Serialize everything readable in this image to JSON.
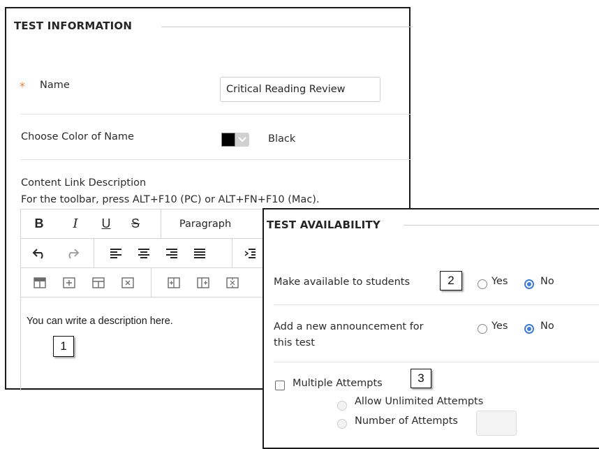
{
  "test_information": {
    "section_title": "TEST INFORMATION",
    "name_required_mark": "*",
    "name_label": "Name",
    "name_value": "Critical Reading Review",
    "color_label": "Choose Color of Name",
    "color_value": "Black",
    "color_swatch": "#000000",
    "content_label": "Content Link Description",
    "toolbar_hint": "For the toolbar, press ALT+F10 (PC) or ALT+FN+F10 (Mac).",
    "toolbar": {
      "bold": "B",
      "italic": "I",
      "underline": "U",
      "strikethrough": "S",
      "paragraph": "Paragraph"
    },
    "editor_text": "You can write a description here."
  },
  "test_availability": {
    "section_title": "TEST AVAILABILITY",
    "make_available_label": "Make available to students",
    "make_available_yes": "Yes",
    "make_available_no": "No",
    "announcement_label_line1": "Add a new announcement for",
    "announcement_label_line2": "this test",
    "announcement_yes": "Yes",
    "announcement_no": "No",
    "multiple_attempts_label": "Multiple Attempts",
    "allow_unlimited_label": "Allow Unlimited Attempts",
    "number_of_attempts_label": "Number of Attempts"
  },
  "callouts": {
    "one": "1",
    "two": "2",
    "three": "3"
  },
  "colors": {
    "accent_blue": "#3d7be0",
    "required_orange": "#e07f32"
  }
}
